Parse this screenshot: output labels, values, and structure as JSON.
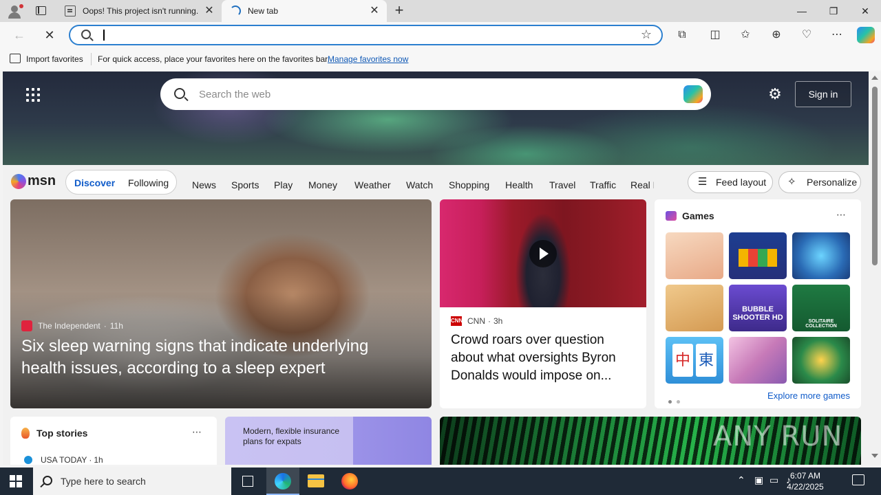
{
  "browser": {
    "tabs": [
      {
        "title": "Oops! This project isn't running."
      },
      {
        "title": "New tab"
      }
    ],
    "address": {
      "value": ""
    },
    "favorites_bar": {
      "import_label": "Import favorites",
      "message": "For quick access, place your favorites here on the favorites bar.",
      "link": "Manage favorites now"
    }
  },
  "msn": {
    "search_placeholder": "Search the web",
    "sign_in": "Sign in",
    "brand": "msn",
    "segments": [
      "Discover",
      "Following"
    ],
    "nav": [
      "News",
      "Sports",
      "Play",
      "Money",
      "Weather",
      "Watch",
      "Shopping",
      "Health",
      "Travel",
      "Traffic",
      "Real E"
    ],
    "feed_layout": "Feed layout",
    "personalize": "Personalize",
    "hero": {
      "source": "The Independent",
      "age": "11h",
      "title": "Six sleep warning signs that indicate underlying health issues, according to a sleep expert"
    },
    "cnn": {
      "source": "CNN",
      "age": "3h",
      "title": "Crowd roars over question about what oversights Byron Donalds would impose on..."
    },
    "games": {
      "title": "Games",
      "explore": "Explore more games",
      "tile_labels": [
        "BUBBLE SHOOTER HD",
        "SOLITAIRE COLLECTION"
      ],
      "tile_colors": [
        "#f2c8a0",
        "#1d3e91",
        "#2a6bb5",
        "#e0b678",
        "#5c3fb0",
        "#1e6b3a",
        "#4aa8e8",
        "#d98bc4",
        "#2b8a4a"
      ]
    },
    "top_stories": {
      "title": "Top stories",
      "source": "USA TODAY",
      "age": "1h"
    },
    "ad": {
      "text": "Modern, flexible insurance plans for expats"
    },
    "watermark": "ANY RUN"
  },
  "taskbar": {
    "search_placeholder": "Type here to search",
    "time": "6:07 AM",
    "date": "4/22/2025"
  }
}
